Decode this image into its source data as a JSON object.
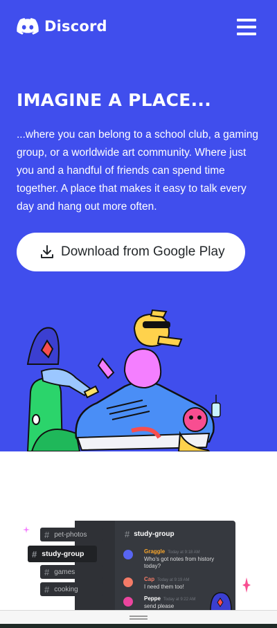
{
  "nav": {
    "brand": "Discord",
    "logo_icon": "discord-logo-icon",
    "menu_icon": "hamburger-menu-icon"
  },
  "hero": {
    "headline": "IMAGINE A PLACE...",
    "description": "...where you can belong to a school club, a gaming group, or a worldwide art community. Where just you and a handful of friends can spend time together. A place that makes it easy to talk every day and hang out more often.",
    "download_icon": "download-icon",
    "download_label": "Download from Google Play"
  },
  "chat_preview": {
    "channels": [
      "pet-photos",
      "study-group",
      "games",
      "cooking"
    ],
    "active_channel": "study-group",
    "header_channel": "study-group",
    "messages": [
      {
        "author": "Graggle",
        "time": "Today at 9:18 AM",
        "text": "Who's got notes from history today?",
        "color": "#F9A62B"
      },
      {
        "author": "Cap",
        "time": "Today at 9:19 AM",
        "text": "I need them too!",
        "color": "#F47B67"
      },
      {
        "author": "Peppe",
        "time": "Today at 9:22 AM",
        "text": "send please",
        "color": "#FFFFFF"
      }
    ]
  },
  "colors": {
    "blurple": "#404EED",
    "dark": "#23272A"
  }
}
